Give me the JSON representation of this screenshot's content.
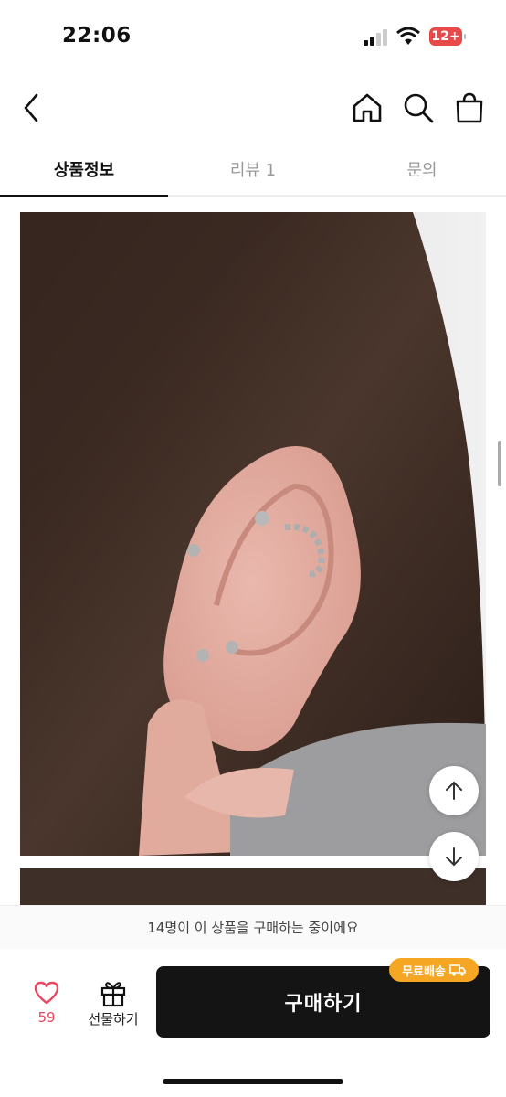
{
  "status_bar": {
    "time": "22:06",
    "battery": "12+",
    "battery_color": "#e84a4a"
  },
  "header": {
    "back_icon": "chevron-left-icon",
    "home_icon": "home-icon",
    "search_icon": "search-icon",
    "bag_icon": "shopping-bag-icon"
  },
  "tabs": [
    {
      "label": "상품정보",
      "active": true
    },
    {
      "label": "리뷰 1",
      "active": false
    },
    {
      "label": "문의",
      "active": false
    }
  ],
  "content": {
    "scroll_up_icon": "arrow-up-icon",
    "scroll_down_icon": "arrow-down-icon"
  },
  "purchase_banner": "14명이 이 상품을 구매하는 중이에요",
  "bottom_bar": {
    "like_count": "59",
    "gift_label": "선물하기",
    "buy_label": "구매하기",
    "shipping_badge": "무료배송",
    "accent_color": "#141414",
    "badge_color": "#f5a623",
    "like_color": "#e8475f"
  }
}
